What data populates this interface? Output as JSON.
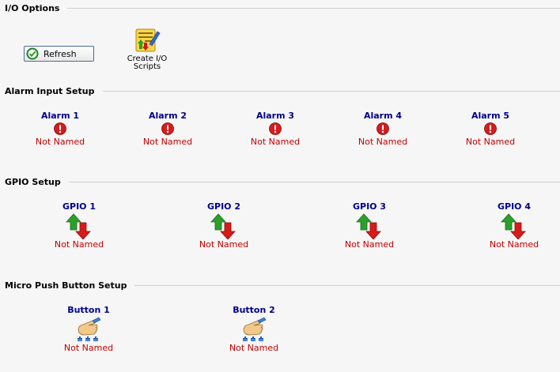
{
  "io_options": {
    "title": "I/O Options",
    "refresh_label": "Refresh",
    "create_scripts_label_line1": "Create I/O",
    "create_scripts_label_line2": "Scripts"
  },
  "alarm_input": {
    "title": "Alarm Input Setup",
    "items": [
      {
        "name": "Alarm 1",
        "status": "Not Named"
      },
      {
        "name": "Alarm 2",
        "status": "Not Named"
      },
      {
        "name": "Alarm 3",
        "status": "Not Named"
      },
      {
        "name": "Alarm 4",
        "status": "Not Named"
      },
      {
        "name": "Alarm 5",
        "status": "Not Named"
      }
    ]
  },
  "gpio": {
    "title": "GPIO Setup",
    "items": [
      {
        "name": "GPIO 1",
        "status": "Not Named"
      },
      {
        "name": "GPIO 2",
        "status": "Not Named"
      },
      {
        "name": "GPIO 3",
        "status": "Not Named"
      },
      {
        "name": "GPIO 4",
        "status": "Not Named"
      }
    ]
  },
  "push_button": {
    "title": "Micro Push Button Setup",
    "items": [
      {
        "name": "Button 1",
        "status": "Not Named"
      },
      {
        "name": "Button 2",
        "status": "Not Named"
      }
    ]
  },
  "icons": {
    "refresh": "green-check-icon",
    "scripts": "notepad-pencil-icon",
    "alarm": "red-alert-icon",
    "gpio": "up-down-arrows-icon",
    "button": "pointing-hand-icon"
  },
  "colors": {
    "item_title": "#00008b",
    "status_text": "#c00000",
    "background": "#f6f6f6"
  }
}
